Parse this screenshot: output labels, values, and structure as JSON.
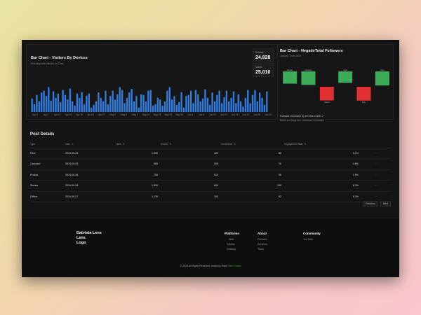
{
  "visitors_card": {
    "title": "Bar Chart - Visitors By Devices",
    "subtitle": "Showing total visitors for Time",
    "stats": [
      {
        "label": "Desktop",
        "value": "24,828"
      },
      {
        "label": "Mobile",
        "value": "25,010"
      }
    ]
  },
  "followers_card": {
    "title": "Bar Chart - NegativTotal Followers",
    "subtitle": "January - June 2024",
    "trend": "Followers increase by 2% this month ↗",
    "note": "Month and blogs see a decrease in followers"
  },
  "chart_data": [
    {
      "type": "bar",
      "categories": [
        "Apr 3",
        "Apr 7",
        "Apr 11",
        "Apr 15",
        "Apr 19",
        "Apr 23",
        "Apr 27",
        "May 1",
        "May 5",
        "May 9",
        "May 14",
        "May 19",
        "May 23",
        "May 28",
        "Jun 1",
        "Jun 6",
        "Jun 10",
        "Jun 14",
        "Jun 18",
        "Jun 22",
        "Jun 26",
        "Jun 30"
      ],
      "values": [
        38,
        22,
        48,
        30,
        55,
        60,
        45,
        70,
        32,
        58,
        40,
        52,
        28,
        62,
        48,
        35,
        66,
        30,
        18,
        52,
        40,
        56,
        22,
        46,
        52,
        12,
        20,
        30,
        55,
        40,
        30,
        60,
        22,
        45,
        60,
        35,
        50,
        70,
        62,
        25,
        40,
        55,
        65,
        30,
        45,
        12,
        50,
        48,
        30,
        60,
        62,
        18,
        22,
        40,
        35,
        18,
        30,
        60,
        70,
        35,
        45,
        20,
        28,
        56,
        12,
        45,
        48,
        60,
        25,
        62,
        50,
        30,
        38,
        64,
        40,
        20,
        55,
        30,
        48,
        60,
        25,
        42,
        60,
        30,
        40,
        58,
        25,
        50,
        30,
        15,
        40,
        62,
        25,
        48,
        62,
        30,
        55,
        40,
        20,
        58
      ],
      "ylim": [
        0,
        75
      ]
    },
    {
      "type": "bar",
      "categories": [
        "January",
        "February",
        "March",
        "April",
        "May",
        "June"
      ],
      "values": [
        186,
        205,
        -207,
        173,
        -209,
        214
      ],
      "data_labels": [
        "January",
        "February",
        "March",
        "April",
        "May",
        "June"
      ],
      "ylim": [
        -260,
        260
      ]
    }
  ],
  "posts": {
    "title": "Post Details",
    "columns": [
      "Type",
      "Date",
      "Likes",
      "Shares",
      "Comments",
      "Engagement Rate"
    ],
    "rows": [
      {
        "type": "Reel",
        "date": "2024-05-24",
        "likes": "1,050",
        "shares": "422",
        "comments": "88",
        "rate": "5.2%"
      },
      {
        "type": "Carousel",
        "date": "2024-05-25",
        "likes": "980",
        "shares": "305",
        "comments": "76",
        "rate": "4.8%"
      },
      {
        "type": "Photos",
        "date": "2024-05-26",
        "likes": "750",
        "shares": "512",
        "comments": "95",
        "rate": "3.9%"
      },
      {
        "type": "Stories",
        "date": "2024-05-26",
        "likes": "1,500",
        "shares": "600",
        "comments": "150",
        "rate": "6.3%"
      },
      {
        "type": "Offline",
        "date": "2024-05-27",
        "likes": "1,130",
        "shares": "303",
        "comments": "82",
        "rate": "5.3%"
      }
    ],
    "row_menu": "···",
    "prev_label": "Previous",
    "next_label": "Next"
  },
  "footer": {
    "logo": "Datvista Lens\nLens\nLogo",
    "columns": [
      {
        "heading": "Platforms",
        "links": [
          "Web",
          "Mobile",
          "Desktop"
        ]
      },
      {
        "heading": "About",
        "links": [
          "Partners",
          "Services",
          "Team"
        ]
      },
      {
        "heading": "Community",
        "links": [
          "YouTube"
        ]
      }
    ],
    "copyright": "© 2023 All Rights Reserved, made by Team",
    "brand": "Zero Codes"
  },
  "colors": {
    "bar_blue": "#2f7de1",
    "positive": "#3dab57",
    "negative": "#e0302f",
    "brand_green": "#4caf50"
  }
}
